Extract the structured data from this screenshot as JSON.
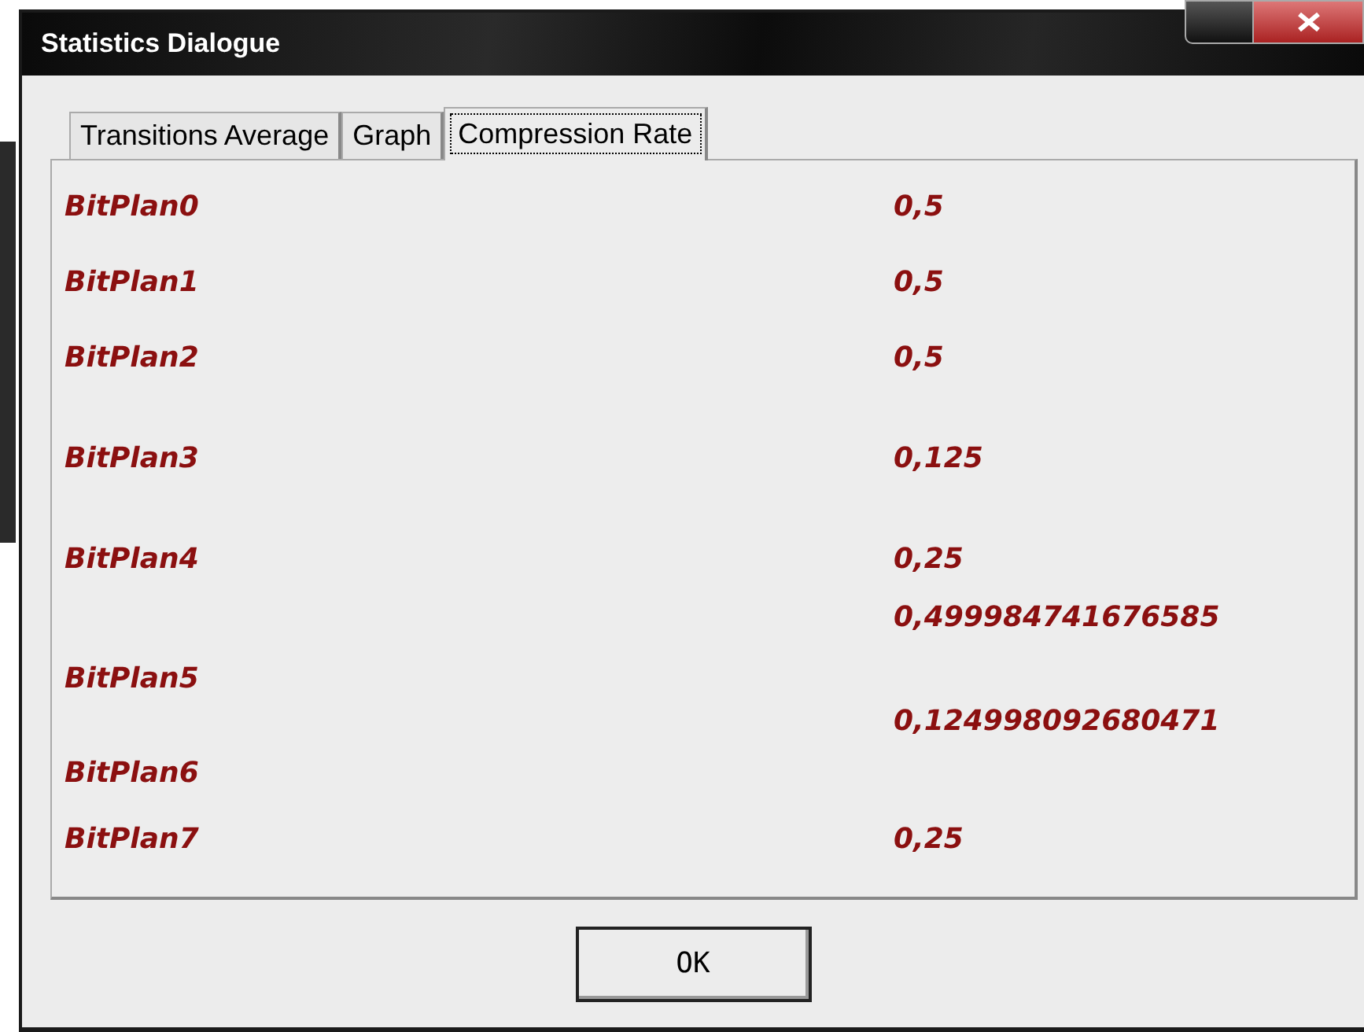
{
  "window": {
    "title": "Statistics Dialogue"
  },
  "tabs": [
    {
      "label": "Transitions Average",
      "selected": false
    },
    {
      "label": "Graph",
      "selected": false
    },
    {
      "label": "Compression Rate",
      "selected": true
    }
  ],
  "rows": [
    {
      "label": "BitPlan0",
      "value": "0,5"
    },
    {
      "label": "BitPlan1",
      "value": "0,5"
    },
    {
      "label": "BitPlan2",
      "value": "0,5"
    },
    {
      "label": "BitPlan3",
      "value": "0,125"
    },
    {
      "label": "BitPlan4",
      "value": "0,25"
    },
    {
      "label": "BitPlan5",
      "value": "0,499984741676585"
    },
    {
      "label": "BitPlan6",
      "value": "0,124998092680471"
    },
    {
      "label": "BitPlan7",
      "value": "0,25"
    }
  ],
  "buttons": [
    "OK"
  ]
}
